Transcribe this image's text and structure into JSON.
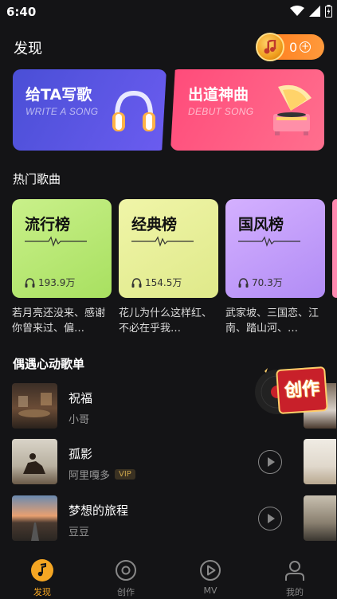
{
  "status_bar": {
    "time": "6:40"
  },
  "header": {
    "title": "发现",
    "coins": "0"
  },
  "banners": [
    {
      "title": "给TA写歌",
      "subtitle": "WRITE A SONG"
    },
    {
      "title": "出道神曲",
      "subtitle": "DEBUT SONG"
    }
  ],
  "hot_songs": {
    "title": "热门歌曲",
    "charts": [
      {
        "name": "流行榜",
        "plays": "193.9万",
        "desc": "若月亮还没来、感谢你曾来过、偏…"
      },
      {
        "name": "经典榜",
        "plays": "154.5万",
        "desc": "花儿为什么这样红、不必在乎我…"
      },
      {
        "name": "国风榜",
        "plays": "70.3万",
        "desc": "武家坡、三国恋、江南、踏山河、…"
      }
    ]
  },
  "playlist": {
    "title": "偶遇心动歌单",
    "songs": [
      {
        "name": "祝福",
        "artist": "小哥",
        "vip": ""
      },
      {
        "name": "孤影",
        "artist": "阿里嘎多",
        "vip": "VIP"
      },
      {
        "name": "梦想的旅程",
        "artist": "豆豆",
        "vip": ""
      }
    ]
  },
  "create_button": {
    "label": "创作"
  },
  "tab_bar": {
    "tabs": [
      {
        "label": "发现",
        "icon": "music-note-icon",
        "active": true
      },
      {
        "label": "创作",
        "icon": "disc-icon",
        "active": false
      },
      {
        "label": "MV",
        "icon": "play-icon",
        "active": false
      },
      {
        "label": "我的",
        "icon": "user-icon",
        "active": false
      }
    ]
  },
  "colors": {
    "accent": "#f5a623",
    "background": "#141416"
  }
}
